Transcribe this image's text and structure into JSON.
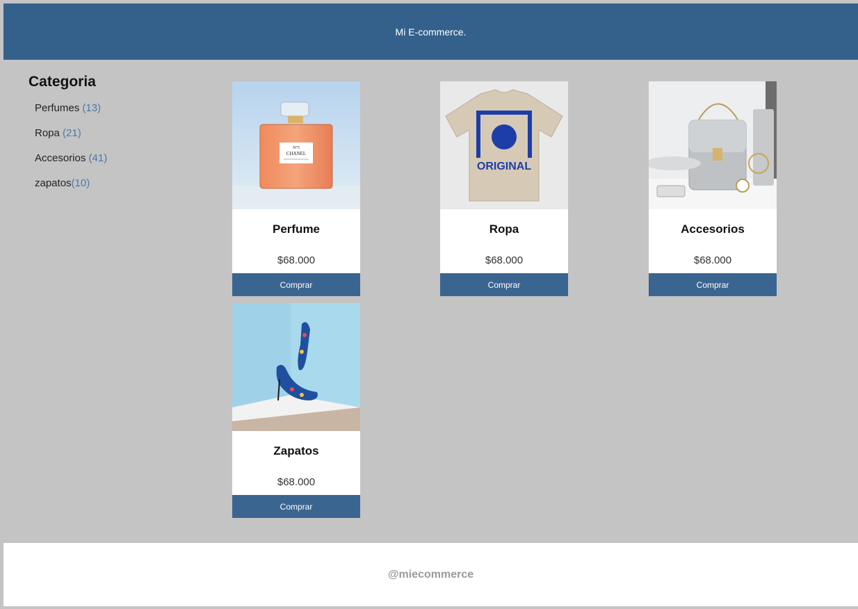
{
  "header": {
    "title": "Mi E-commerce."
  },
  "sidebar": {
    "title": "Categoria",
    "items": [
      {
        "label": "Perfumes",
        "count": "(13)",
        "sep": " "
      },
      {
        "label": "Ropa",
        "count": "(21)",
        "sep": " "
      },
      {
        "label": "Accesorios",
        "count": "(41)",
        "sep": " "
      },
      {
        "label": "zapatos",
        "count": "(10)",
        "sep": ""
      }
    ]
  },
  "products": [
    {
      "title": "Perfume",
      "price": "$68.000",
      "button": "Comprar",
      "icon": "perfume-image"
    },
    {
      "title": "Ropa",
      "price": "$68.000",
      "button": "Comprar",
      "icon": "tshirt-image",
      "shirt_text": "ORIGINAL"
    },
    {
      "title": "Accesorios",
      "price": "$68.000",
      "button": "Comprar",
      "icon": "handbag-image"
    },
    {
      "title": "Zapatos",
      "price": "$68.000",
      "button": "Comprar",
      "icon": "heels-image"
    }
  ],
  "footer": {
    "text": "@miecommerce"
  },
  "colors": {
    "header": "#33618c",
    "button": "#3a6590",
    "background": "#c4c4c4"
  }
}
